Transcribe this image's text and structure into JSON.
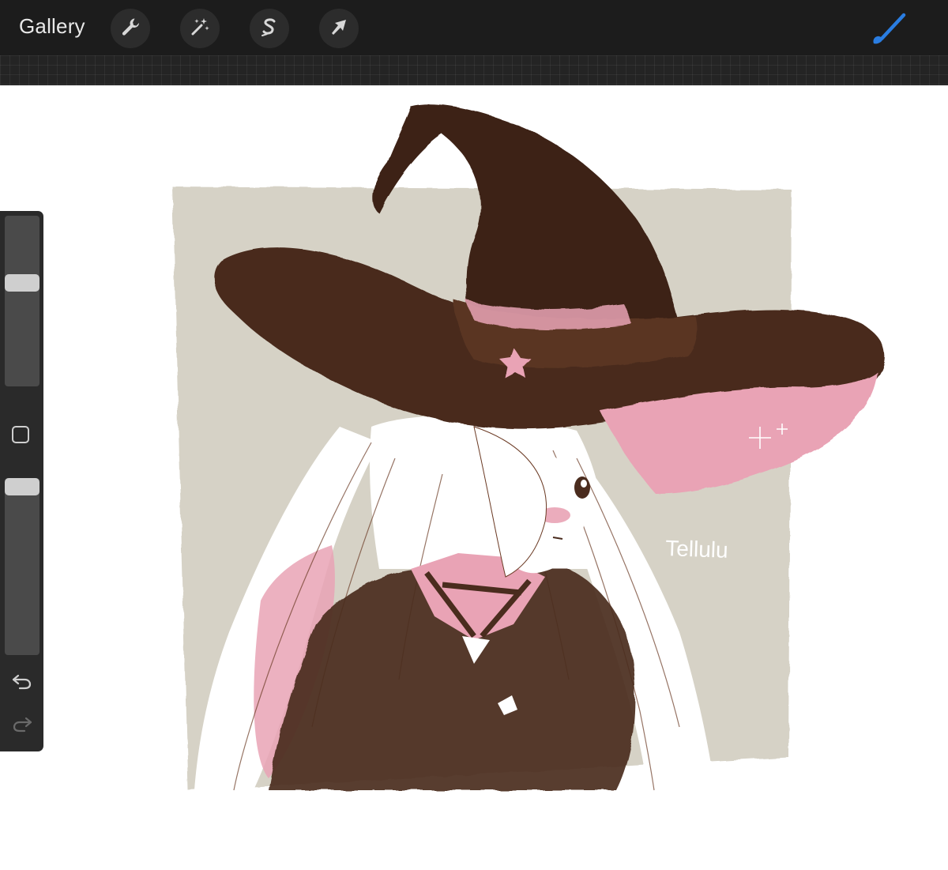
{
  "toolbar": {
    "gallery_label": "Gallery",
    "tools": [
      {
        "name": "actions",
        "icon": "wrench-icon"
      },
      {
        "name": "adjustments",
        "icon": "magic-wand-icon"
      },
      {
        "name": "selection",
        "icon": "selection-s-icon"
      },
      {
        "name": "transform",
        "icon": "arrow-cursor-icon"
      }
    ],
    "active_tool_icon": "brush-icon"
  },
  "sidebar": {
    "brush_size_level": 0.62,
    "opacity_level": 1.0,
    "buttons": [
      "modify-square-icon",
      "undo-icon",
      "redo-icon"
    ]
  },
  "artwork": {
    "signature": "Tellulu"
  },
  "colors": {
    "toolbar_bg": "#1c1c1c",
    "accent": "#2a7de1",
    "paper_bg": "#d6d2c6",
    "ink_brown": "#4a2c1e",
    "pink": "#e9a3b5"
  }
}
